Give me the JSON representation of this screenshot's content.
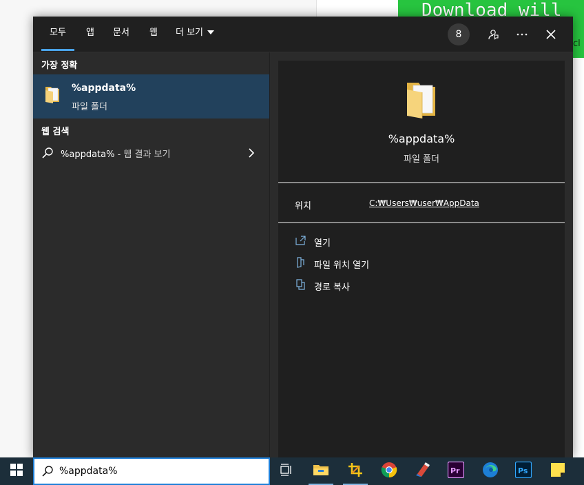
{
  "background": {
    "banner_text": "Download will",
    "banner_stub": "cl"
  },
  "tabs": [
    {
      "label": "모두",
      "active": true
    },
    {
      "label": "앱"
    },
    {
      "label": "문서"
    },
    {
      "label": "웹"
    },
    {
      "label": "더 보기"
    }
  ],
  "header": {
    "badge": "8",
    "feedback_icon": "feedback-icon",
    "more_icon": "ellipsis-icon",
    "close_icon": "close-icon"
  },
  "left": {
    "best_match_title": "가장 정확",
    "best_match": {
      "name": "%appdata%",
      "type": "파일 폴더"
    },
    "web_title": "웹 검색",
    "web_item": {
      "query": "%appdata%",
      "suffix": " - 웹 결과 보기"
    }
  },
  "detail": {
    "name": "%appdata%",
    "type": "파일 폴더",
    "location_label": "위치",
    "location_value": "C:₩Users₩user₩AppData",
    "actions": [
      {
        "label": "열기",
        "icon": "open-icon"
      },
      {
        "label": "파일 위치 열기",
        "icon": "file-location-icon"
      },
      {
        "label": "경로 복사",
        "icon": "copy-path-icon"
      }
    ]
  },
  "taskbar": {
    "search_value": "%appdata%",
    "apps": [
      "task-view",
      "file-explorer",
      "snipping-tool",
      "chrome",
      "ccleaner",
      "premiere-pro",
      "edge",
      "photoshop",
      "sticky-notes"
    ]
  },
  "colors": {
    "accent": "#4aa3e8",
    "selected_bg": "#22415c",
    "panel_bg": "#2b2b2b",
    "taskbar_bg": "#1c2e3a"
  }
}
